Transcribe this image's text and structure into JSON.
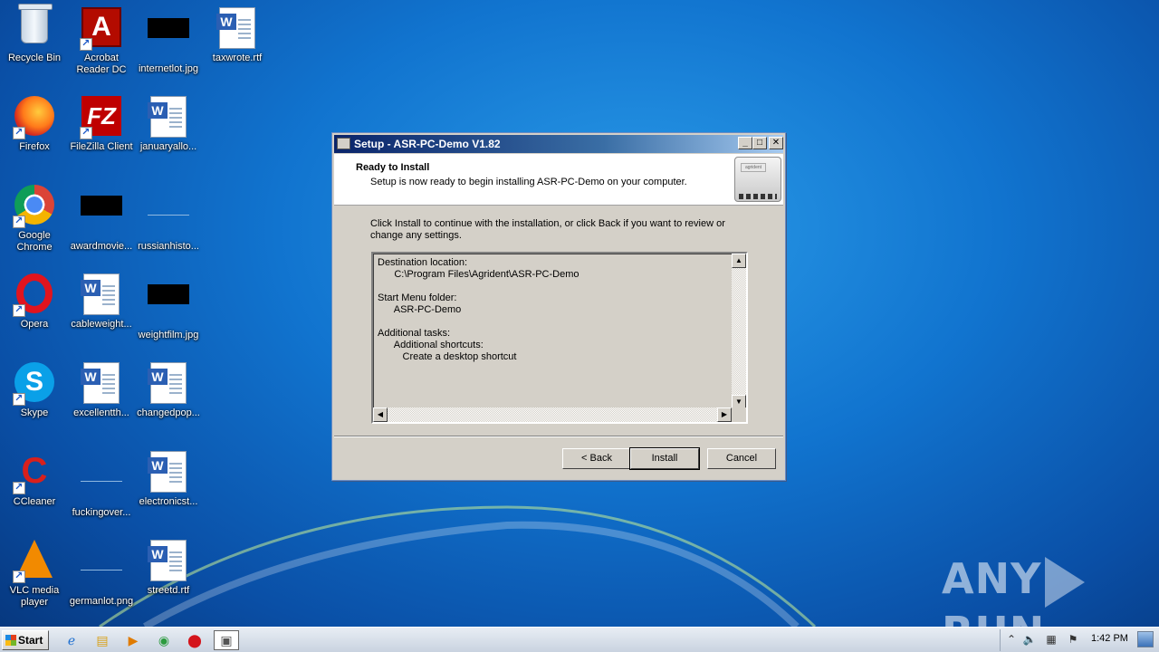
{
  "desktop": {
    "icons": [
      {
        "label": "Recycle Bin",
        "icon": "recycle-bin-icon"
      },
      {
        "label": "Acrobat Reader DC",
        "icon": "acrobat-icon"
      },
      {
        "label": "internetlot.jpg",
        "icon": "image-file-icon"
      },
      {
        "label": "taxwrote.rtf",
        "icon": "word-doc-icon"
      },
      {
        "label": "Firefox",
        "icon": "firefox-icon"
      },
      {
        "label": "FileZilla Client",
        "icon": "filezilla-icon"
      },
      {
        "label": "januaryallo...",
        "icon": "word-doc-icon"
      },
      {
        "label": "Google Chrome",
        "icon": "chrome-icon"
      },
      {
        "label": "awardmovie...",
        "icon": "image-file-icon"
      },
      {
        "label": "russianhisto...",
        "icon": "blank-file-icon"
      },
      {
        "label": "Opera",
        "icon": "opera-icon"
      },
      {
        "label": "cableweight...",
        "icon": "word-doc-icon"
      },
      {
        "label": "weightfilm.jpg",
        "icon": "image-file-icon"
      },
      {
        "label": "Skype",
        "icon": "skype-icon"
      },
      {
        "label": "excellentth...",
        "icon": "word-doc-icon"
      },
      {
        "label": "changedpop...",
        "icon": "word-doc-icon"
      },
      {
        "label": "CCleaner",
        "icon": "ccleaner-icon"
      },
      {
        "label": "fuckingover...",
        "icon": "blank-file-icon"
      },
      {
        "label": "electronicst...",
        "icon": "word-doc-icon"
      },
      {
        "label": "VLC media player",
        "icon": "vlc-icon"
      },
      {
        "label": "germanlot.png",
        "icon": "blank-file-icon"
      },
      {
        "label": "streetd.rtf",
        "icon": "word-doc-icon"
      }
    ]
  },
  "watermark": {
    "left": "ANY",
    "right": "RUN"
  },
  "dialog": {
    "title": "Setup - ASR-PC-Demo V1.82",
    "header_title": "Ready to Install",
    "header_subtitle": "Setup is now ready to begin installing ASR-PC-Demo on your computer.",
    "header_image_text": "agrident",
    "intro": "Click Install to continue with the installation, or click Back if you want to review or change any settings.",
    "memo": "Destination location:\n      C:\\Program Files\\Agrident\\ASR-PC-Demo\n\nStart Menu folder:\n      ASR-PC-Demo\n\nAdditional tasks:\n      Additional shortcuts:\n         Create a desktop shortcut",
    "buttons": {
      "back": "< Back",
      "install": "Install",
      "cancel": "Cancel"
    },
    "title_buttons": {
      "minimize": "_",
      "maximize": "□",
      "close": "✕"
    }
  },
  "taskbar": {
    "start_label": "Start",
    "clock": "1:42 PM",
    "pinned": [
      "ie-icon",
      "explorer-icon",
      "media-player-icon",
      "chrome-icon",
      "opera-icon",
      "setup-icon"
    ]
  }
}
